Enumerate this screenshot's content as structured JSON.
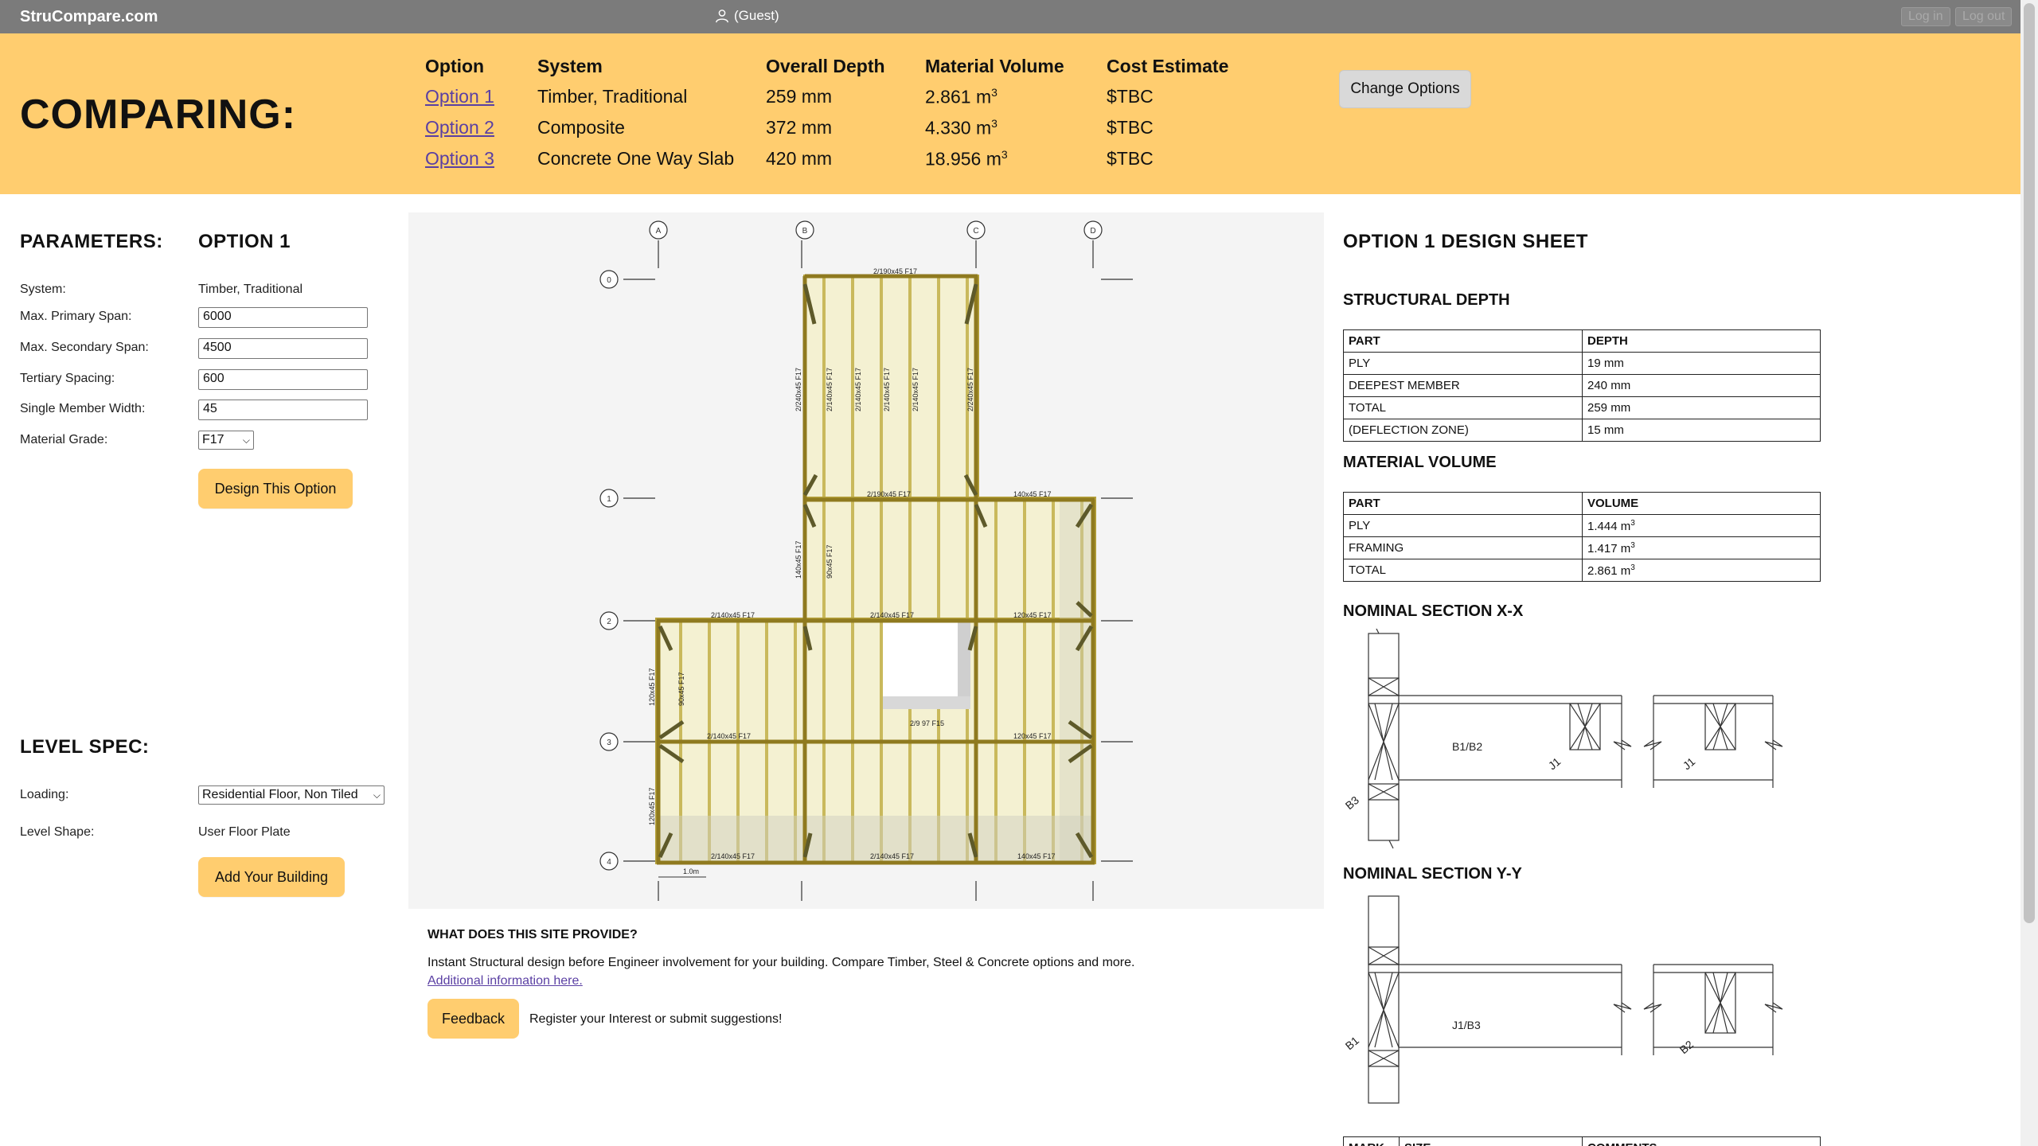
{
  "topbar": {
    "brand": "StruCompare.com",
    "user": "(Guest)",
    "login": "Log in",
    "logout": "Log out"
  },
  "compare": {
    "title": "COMPARING:",
    "headers": [
      "Option",
      "System",
      "Overall Depth",
      "Material Volume",
      "Cost Estimate"
    ],
    "rows": [
      {
        "option": "Option 1",
        "system": "Timber, Traditional",
        "depth": "259 mm",
        "volume": "2.861 m",
        "cost": "$TBC"
      },
      {
        "option": "Option 2",
        "system": "Composite",
        "depth": "372 mm",
        "volume": "4.330 m",
        "cost": "$TBC"
      },
      {
        "option": "Option 3",
        "system": "Concrete One Way Slab",
        "depth": "420 mm",
        "volume": "18.956 m",
        "cost": "$TBC"
      }
    ],
    "sup": "3",
    "change_button": "Change Options"
  },
  "parameters": {
    "title": "PARAMETERS:",
    "option_title": "OPTION 1",
    "system_label": "System:",
    "system_value": "Timber, Traditional",
    "primary_label": "Max. Primary Span:",
    "primary_value": "6000",
    "secondary_label": "Max. Secondary Span:",
    "secondary_value": "4500",
    "tertiary_label": "Tertiary Spacing:",
    "tertiary_value": "600",
    "width_label": "Single Member Width:",
    "width_value": "45",
    "grade_label": "Material Grade:",
    "grade_value": "F17",
    "design_button": "Design This Option"
  },
  "level": {
    "title": "LEVEL SPEC:",
    "loading_label": "Loading:",
    "loading_value": "Residential Floor, Non Tiled",
    "shape_label": "Level Shape:",
    "shape_value": "User Floor Plate",
    "add_button": "Add Your Building"
  },
  "plan": {
    "grid_cols": [
      "A",
      "B",
      "C",
      "D"
    ],
    "grid_rows": [
      "0",
      "1",
      "2",
      "3",
      "4"
    ],
    "beam_labels": [
      "2/190x45 F17",
      "2/190x45 F17",
      "140x45 F17",
      "2/140x45 F17",
      "2/140x45 F17",
      "120x45 F17",
      "2/140x45 F17",
      "120x45 F17",
      "2/140x45 F17",
      "2/140x45 F17",
      "140x45 F17"
    ],
    "joist_labels": [
      "2/240x45 F17",
      "2/140x45 F17",
      "2/140x45 F17",
      "2/140x45 F17",
      "2/140x45 F17",
      "2/240x45 F17",
      "140x45 F17",
      "90x45 F17",
      "120x45 F17",
      "90x45 F17",
      "120x45 F17"
    ],
    "scale_label": "1.0m",
    "void_label": "2/9 97 F15"
  },
  "info": {
    "title": "WHAT DOES THIS SITE PROVIDE?",
    "text": "Instant Structural design before Engineer involvement for your building. Compare Timber, Steel & Concrete options and more.",
    "link": "Additional information here.",
    "feedback_button": "Feedback",
    "feedback_text": "Register your Interest or submit suggestions!"
  },
  "design_sheet": {
    "title": "OPTION 1 DESIGN SHEET",
    "depth_title": "STRUCTURAL DEPTH",
    "depth_headers": [
      "PART",
      "DEPTH"
    ],
    "depth_rows": [
      [
        "PLY",
        "19 mm"
      ],
      [
        "DEEPEST MEMBER",
        "240 mm"
      ],
      [
        "TOTAL",
        "259 mm"
      ],
      [
        "(DEFLECTION ZONE)",
        "15 mm"
      ]
    ],
    "volume_title": "MATERIAL VOLUME",
    "volume_headers": [
      "PART",
      "VOLUME"
    ],
    "volume_rows": [
      [
        "PLY",
        "1.444 m"
      ],
      [
        "FRAMING",
        "1.417 m"
      ],
      [
        "TOTAL",
        "2.861 m"
      ]
    ],
    "sup": "3",
    "section_xx_title": "NOMINAL SECTION X-X",
    "section_xx_labels": [
      "B1/B2",
      "J1",
      "J1",
      "B3"
    ],
    "section_yy_title": "NOMINAL SECTION Y-Y",
    "section_yy_labels": [
      "J1/B3",
      "B1",
      "B2"
    ],
    "bottom_headers": [
      "MARK",
      "SIZE",
      "COMMENTS"
    ]
  }
}
